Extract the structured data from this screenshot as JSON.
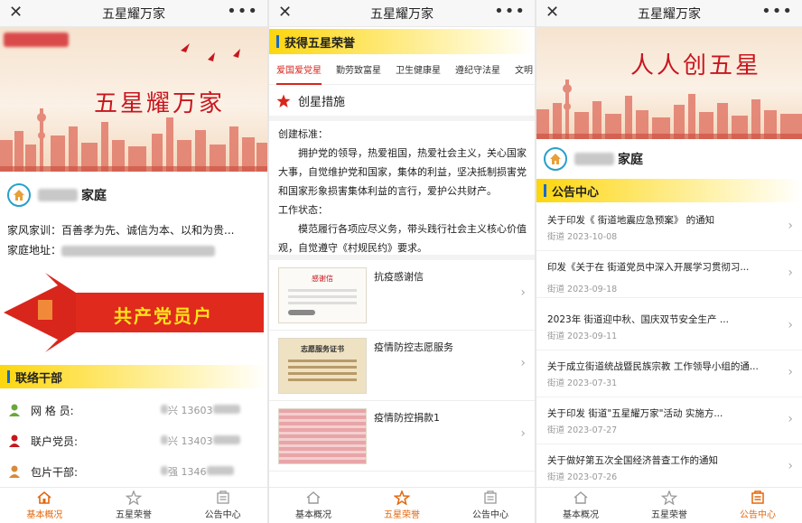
{
  "colors": {
    "accent": "#e4670c",
    "red": "#c8161e",
    "section_yellow": "#fdd60e",
    "section_bar": "#1a68c9"
  },
  "window": {
    "title": "五星耀万家",
    "close_icon": "close-icon",
    "more_icon": "more-icon",
    "close_glyph": "✕",
    "more_glyph": "•••"
  },
  "tabbar": [
    {
      "label": "基本概况",
      "icon": "home-icon"
    },
    {
      "label": "五星荣誉",
      "icon": "star-icon"
    },
    {
      "label": "公告中心",
      "icon": "notice-icon"
    }
  ],
  "panel1": {
    "banner_text": "五星耀万家",
    "family_name": "家庭",
    "motto_label": "家风家训：",
    "motto": "百善孝为先、诚信为本、以和为贵...",
    "address_label": "家庭地址：",
    "ribbon_text": "共产党员户",
    "contacts_title": "联络干部",
    "contacts": [
      {
        "role": "网 格 员:",
        "value": "兴 13603"
      },
      {
        "role": "联户党员:",
        "value": "兴 13403"
      },
      {
        "role": "包片干部:",
        "value": "强 1346"
      }
    ]
  },
  "panel2": {
    "header": "获得五星荣誉",
    "categories": [
      "爱国爱党星",
      "勤劳致富星",
      "卫生健康星",
      "遵纪守法星",
      "文明"
    ],
    "measures_title": "创星措施",
    "standard_label": "创建标准：",
    "standard_text": "拥护党的领导，热爱祖国，热爱社会主义，关心国家大事，自觉维护党和国家，集体的利益，坚决抵制损害党和国家形象损害集体利益的言行，爱护公共财产。",
    "status_label": "工作状态：",
    "status_text": "模范履行各项应尽义务，带头践行社会主义核心价值观，自觉遵守《村规民约》要求。",
    "honors": [
      {
        "title": "抗疫感谢信",
        "thumb_caption": "感谢信"
      },
      {
        "title": "疫情防控志愿服务",
        "thumb_caption": "志愿服务证书"
      },
      {
        "title": "疫情防控捐款1",
        "thumb_caption": ""
      }
    ]
  },
  "panel3": {
    "banner_text": "人人创五星",
    "family_name": "家庭",
    "section_title": "公告中心",
    "notices": [
      {
        "title": "关于印发《    街道地震应急预案》 的通知",
        "meta": "街道 2023-10-08"
      },
      {
        "title": "印发《关于在    街道党员中深入开展学习贯彻习...",
        "meta": "街道 2023-09-18"
      },
      {
        "title": "2023年    街道迎中秋、国庆双节安全生产 ...",
        "meta": "街道 2023-09-11"
      },
      {
        "title": "关于成立街道统战暨民族宗教 工作领导小组的通...",
        "meta": "街道 2023-07-31"
      },
      {
        "title": "关于印发    街道\"五星耀万家\"活动 实施方...",
        "meta": "街道 2023-07-27"
      },
      {
        "title": "关于做好第五次全国经济普查工作的通知",
        "meta": "街道 2023-07-26"
      }
    ]
  }
}
